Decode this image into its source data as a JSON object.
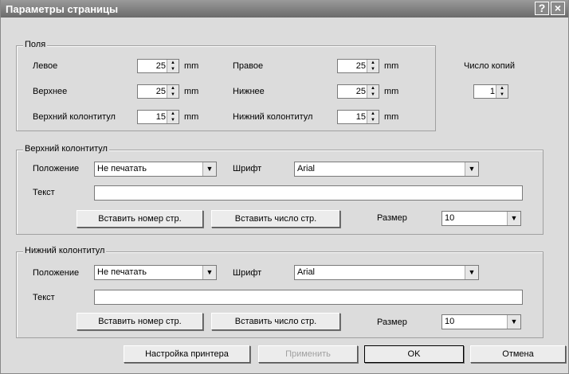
{
  "window": {
    "title": "Параметры страницы",
    "help_icon": "?",
    "close_icon": "×"
  },
  "margins": {
    "legend": "Поля",
    "left_label": "Левое",
    "left_value": "25",
    "top_label": "Верхнее",
    "top_value": "25",
    "header_label": "Верхний колонтитул",
    "header_value": "15",
    "right_label": "Правое",
    "right_value": "25",
    "bottom_label": "Нижнее",
    "bottom_value": "25",
    "footer_label": "Нижний колонтитул",
    "footer_value": "15",
    "unit": "mm"
  },
  "copies": {
    "label": "Число копий",
    "value": "1"
  },
  "header": {
    "legend": "Верхний колонтитул",
    "position_label": "Положение",
    "position_value": "Не печатать",
    "font_label": "Шрифт",
    "font_value": "Arial",
    "text_label": "Текст",
    "text_value": "",
    "insert_page_number": "Вставить номер стр.",
    "insert_page_count": "Вставить число стр.",
    "size_label": "Размер",
    "size_value": "10"
  },
  "footer": {
    "legend": "Нижний колонтитул",
    "position_label": "Положение",
    "position_value": "Не печатать",
    "font_label": "Шрифт",
    "font_value": "Arial",
    "text_label": "Текст",
    "text_value": "",
    "insert_page_number": "Вставить номер стр.",
    "insert_page_count": "Вставить число стр.",
    "size_label": "Размер",
    "size_value": "10"
  },
  "buttons": {
    "printer_setup": "Настройка принтера",
    "apply": "Применить",
    "ok": "OK",
    "cancel": "Отмена"
  }
}
